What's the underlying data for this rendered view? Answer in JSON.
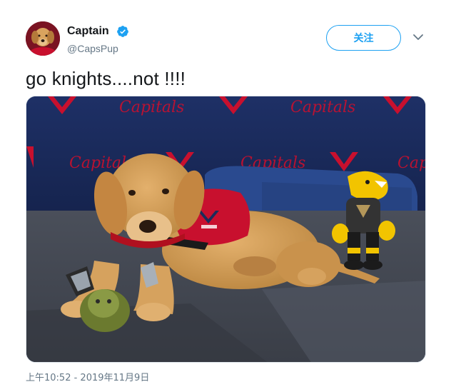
{
  "user": {
    "display_name": "Captain",
    "handle": "@CapsPup",
    "verified": true
  },
  "actions": {
    "follow_label": "关注",
    "caret_icon": "chevron-down-icon"
  },
  "tweet": {
    "text": "go knights....not !!!!",
    "timestamp": "上午10:52 - 2019年11月9日"
  },
  "media": {
    "backdrop_brand_text": "Capitals"
  },
  "colors": {
    "accent": "#1da1f2",
    "text_primary": "#14171a",
    "text_secondary": "#657786",
    "backdrop_navy": "#1c2c5a",
    "capitals_red": "#c8102e"
  }
}
